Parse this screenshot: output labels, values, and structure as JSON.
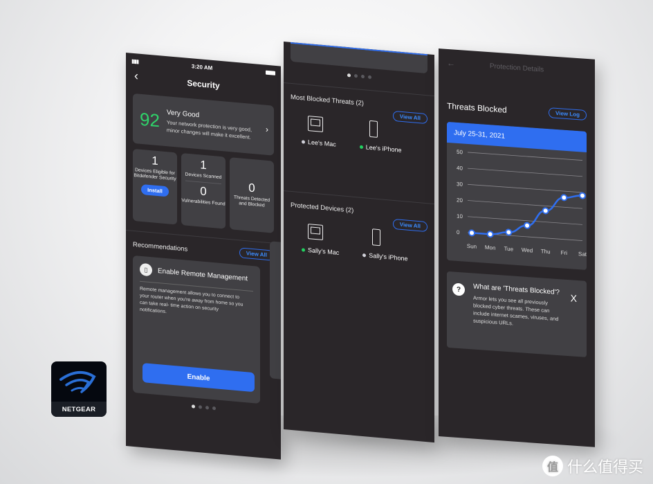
{
  "brand": {
    "name": "NETGEAR"
  },
  "watermark": {
    "badge": "值",
    "text": "什么值得买"
  },
  "phone1": {
    "status": {
      "time": "3:20 AM",
      "signal": "▮▮▮",
      "wifi": "wifi"
    },
    "nav": {
      "back": "‹",
      "title": "Security"
    },
    "score": {
      "value": "92",
      "title": "Very Good",
      "description": "Your network protection is very good, minor changes will make it excellent.",
      "chevron": "›"
    },
    "stats": [
      {
        "value": "1",
        "label": "Devices Eligible for Bitdefender Security",
        "button": "Install"
      },
      {
        "value": "1",
        "label": "Devices Scanned",
        "value2": "0",
        "label2": "Vulnerabilities Found"
      },
      {
        "value": "0",
        "label": "Threats Detected and Blocked"
      }
    ],
    "recommendations": {
      "heading": "Recommendations",
      "view_all": "View All",
      "card": {
        "title": "Enable Remote Management",
        "description": "Remote management allows you to connect to your router when you're away from home so you can take real- time action on security notifications.",
        "button": "Enable"
      }
    },
    "page_dots": {
      "count": 4,
      "active": 0
    }
  },
  "phone2": {
    "page_dots": {
      "count": 4,
      "active": 0
    },
    "most_blocked": {
      "heading": "Most Blocked Threats (2)",
      "view_all": "View All",
      "devices": [
        {
          "name": "Lee's Mac",
          "type": "mac",
          "status_color": "#d0d0d8"
        },
        {
          "name": "Lee's iPhone",
          "type": "phone",
          "status_color": "#22d060"
        }
      ]
    },
    "protected": {
      "heading": "Protected Devices (2)",
      "view_all": "View All",
      "devices": [
        {
          "name": "Sally's Mac",
          "type": "mac",
          "status_color": "#22d060"
        },
        {
          "name": "Sally's iPhone",
          "type": "phone",
          "status_color": "#d0d0d8"
        }
      ]
    }
  },
  "phone3": {
    "nav": {
      "back": "←",
      "title": "Protection Details"
    },
    "threats": {
      "heading": "Threats Blocked",
      "view_log": "View Log",
      "range": "July 25-31, 2021"
    },
    "info": {
      "icon": "?",
      "title": "What are 'Threats Blocked'?",
      "description": "Armor lets you see all previously blocked cyber threats. These can include internet scames, viruses, and suspicious URLs.",
      "close": "X"
    }
  },
  "colors": {
    "accent": "#2f6ef0",
    "good": "#2fd36a",
    "panel": "#2a2629",
    "card": "#414044"
  },
  "chart_data": {
    "type": "line",
    "title": "July 25-31, 2021",
    "categories": [
      "Sun",
      "Mon",
      "Tue",
      "Wed",
      "Thu",
      "Fri",
      "Sat"
    ],
    "values": [
      0,
      0,
      2,
      7,
      17,
      26,
      28
    ],
    "xlabel": "",
    "ylabel": "",
    "yticks": [
      0,
      10,
      20,
      30,
      40,
      50
    ],
    "ylim": [
      0,
      50
    ],
    "grid": true,
    "legend": "none"
  }
}
